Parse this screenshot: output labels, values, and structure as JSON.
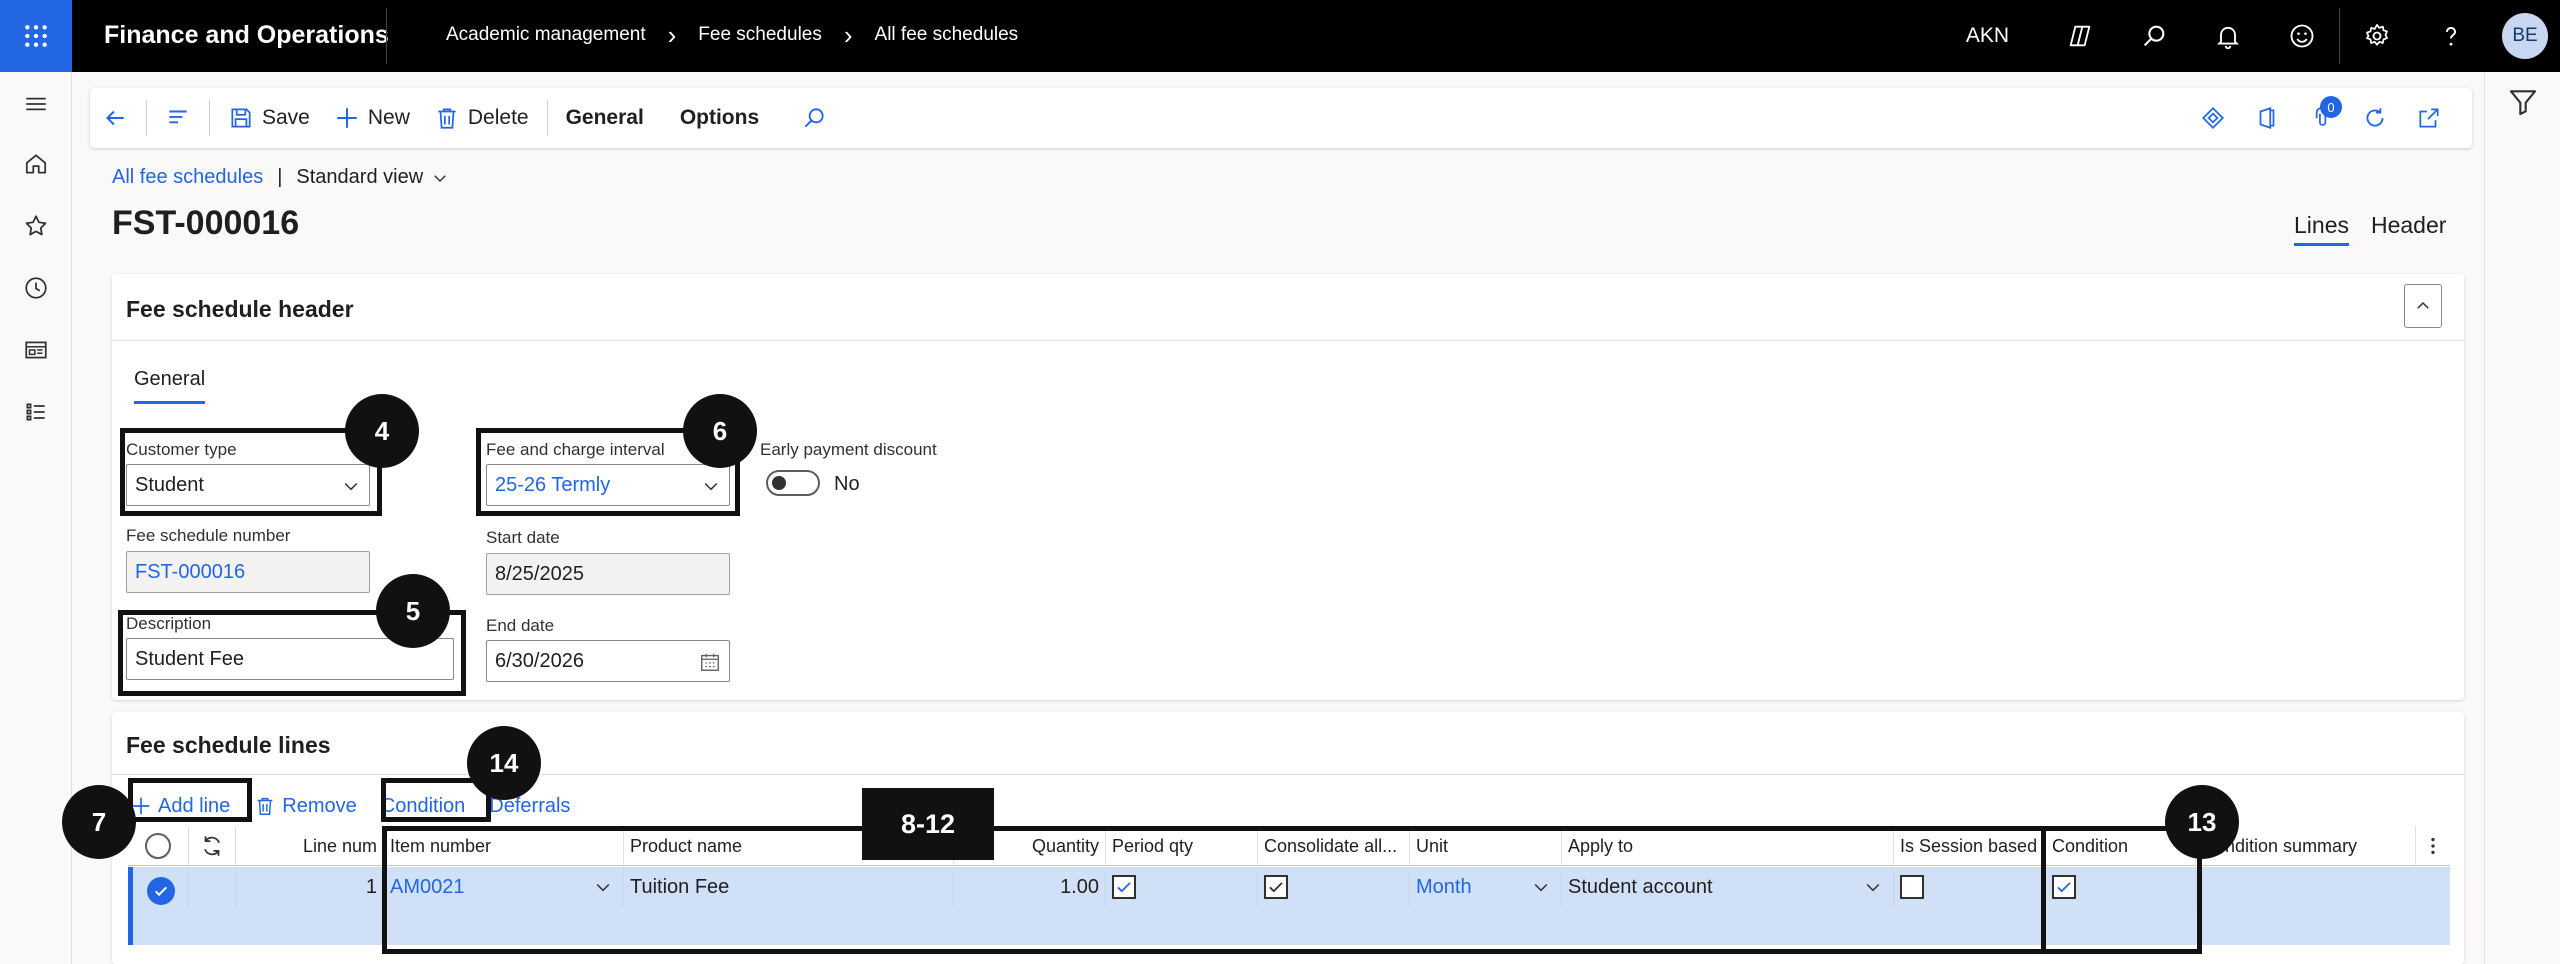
{
  "topbar": {
    "app_title": "Finance and Operations",
    "breadcrumb": [
      "Academic management",
      "Fee schedules",
      "All fee schedules"
    ],
    "company": "AKN",
    "avatar_initials": "BE"
  },
  "actionpane": {
    "save": "Save",
    "new": "New",
    "delete": "Delete",
    "general": "General",
    "options": "Options",
    "attachments_count": "0"
  },
  "page": {
    "crumb_link": "All fee schedules",
    "view": "Standard view",
    "title": "FST-000016",
    "view_tabs": [
      "Lines",
      "Header"
    ]
  },
  "header": {
    "title": "Fee schedule header",
    "tab": "General",
    "customer_type_label": "Customer type",
    "customer_type": "Student",
    "fee_schedule_number_label": "Fee schedule number",
    "fee_schedule_number": "FST-000016",
    "description_label": "Description",
    "description": "Student Fee",
    "interval_label": "Fee and charge interval",
    "interval": "25-26 Termly",
    "start_date_label": "Start date",
    "start_date": "8/25/2025",
    "end_date_label": "End date",
    "end_date": "6/30/2026",
    "early_payment_label": "Early payment discount",
    "early_payment_value": "No"
  },
  "lines": {
    "title": "Fee schedule lines",
    "toolbar": {
      "add_line": "Add line",
      "remove": "Remove",
      "condition": "Condition",
      "deferrals": "Deferrals"
    },
    "columns": {
      "line_num": "Line num",
      "item_number": "Item number",
      "product_name": "Product name",
      "quantity": "Quantity",
      "period_qty": "Period qty",
      "consolidate": "Consolidate all...",
      "unit": "Unit",
      "apply_to": "Apply to",
      "is_session": "Is Session based",
      "condition": "Condition",
      "condition_summary": "Condition summary"
    },
    "rows": [
      {
        "line_num": "1",
        "item_number": "AM0021",
        "product_name": "Tuition Fee",
        "quantity": "1.00",
        "period_qty": true,
        "consolidate": true,
        "unit": "Month",
        "apply_to": "Student account",
        "is_session": false,
        "condition": true,
        "condition_summary": ""
      }
    ]
  },
  "callouts": {
    "c4": "4",
    "c5": "5",
    "c6": "6",
    "c7": "7",
    "c8_12": "8-12",
    "c13": "13",
    "c14": "14"
  },
  "colors": {
    "accent": "#2266e3",
    "topbar": "#000000",
    "selected_row": "#cfe0f7",
    "annotation": "#111111"
  }
}
